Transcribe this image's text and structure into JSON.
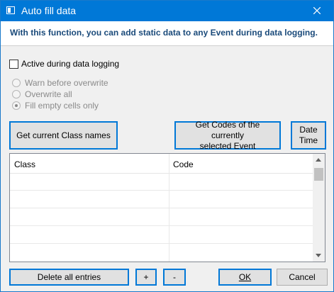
{
  "window": {
    "title": "Auto fill data",
    "close_symbol": "✕"
  },
  "header": {
    "text": "With this function, you can add static data to any Event during data logging."
  },
  "options": {
    "active_label": "Active during data logging",
    "active_checked": false,
    "radios": [
      {
        "label": "Warn before overwrite",
        "checked": false
      },
      {
        "label": "Overwrite all",
        "checked": false
      },
      {
        "label": "Fill empty cells only",
        "checked": true
      }
    ]
  },
  "buttons": {
    "get_class_names": "Get current Class names",
    "get_codes_line1": "Get Codes of the currently",
    "get_codes_line2": "selected Event",
    "date_time_line1": "Date",
    "date_time_line2": "Time",
    "delete_all": "Delete all entries",
    "plus": "+",
    "minus": "-",
    "ok": "OK",
    "cancel": "Cancel"
  },
  "table": {
    "columns": [
      "Class",
      "Code"
    ],
    "rows": []
  },
  "colors": {
    "titlebar": "#0078d7",
    "accent": "#0078d7",
    "header_text": "#1a4a7a"
  }
}
